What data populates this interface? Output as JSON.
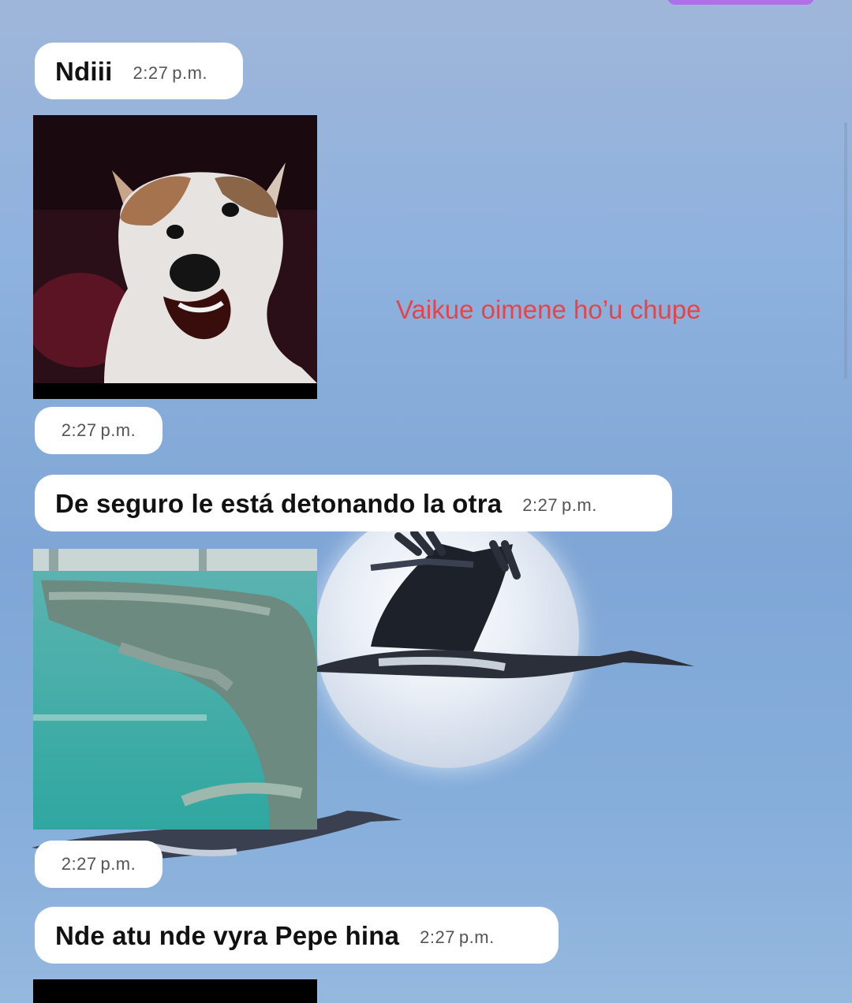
{
  "messages": [
    {
      "text": "Ndiii",
      "time": "2:27 p.m."
    },
    {
      "media": "dog-meme-video",
      "time": "2:27 p.m."
    },
    {
      "text": "De seguro le está detonando la otra",
      "time": "2:27 p.m."
    },
    {
      "media": "crocodile-aquarium-video",
      "time": "2:27 p.m."
    },
    {
      "text": "Nde atu nde vyra Pepe hina",
      "time": "2:27 p.m."
    },
    {
      "media": "dark-video-preview"
    }
  ],
  "overlay_caption": "Vaikue oimene ho’u chupe",
  "colors": {
    "caption": "#e8434a",
    "bubble": "#ffffff",
    "accent_tab": "#b06ee8"
  }
}
